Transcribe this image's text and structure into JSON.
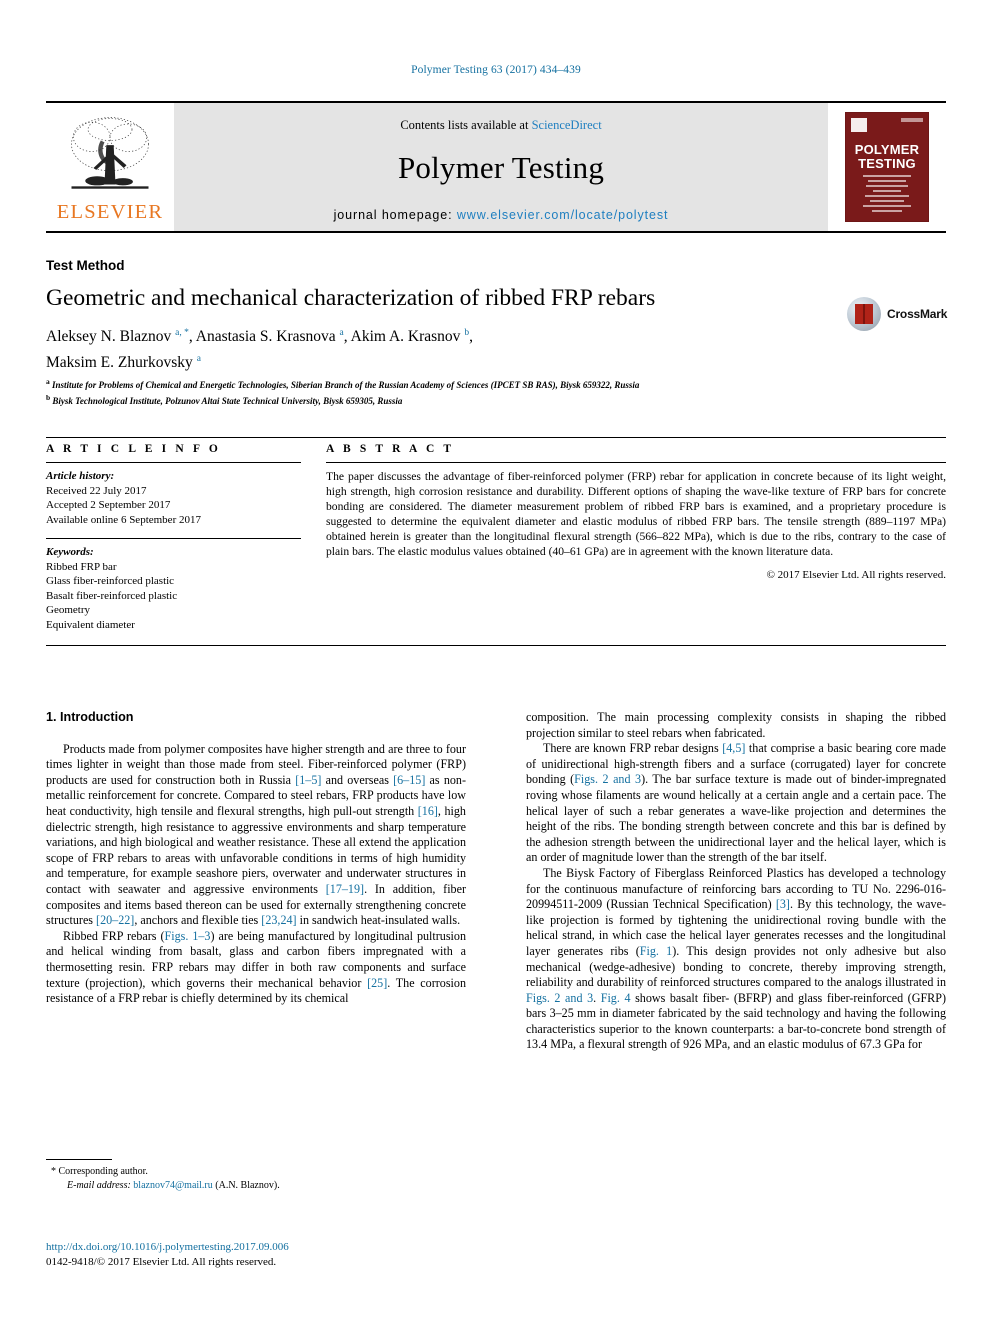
{
  "running_head": "Polymer Testing 63 (2017) 434–439",
  "masthead": {
    "publisher_name": "ELSEVIER",
    "tree_icon": "elsevier-tree-icon",
    "contents_prefix": "Contents lists available at ",
    "contents_link": "ScienceDirect",
    "journal_title": "Polymer Testing",
    "homepage_label": "journal homepage: ",
    "homepage_url": "www.elsevier.com/locate/polytest",
    "cover": {
      "title_line1": "POLYMER",
      "title_line2": "TESTING"
    }
  },
  "article": {
    "section_label": "Test Method",
    "title": "Geometric and mechanical characterization of ribbed FRP rebars",
    "crossmark_label": "CrossMark",
    "authors_line1_a": "Aleksey N. Blaznov ",
    "authors_line1_b": ", Anastasia S. Krasnova ",
    "authors_line1_c": ", Akim A. Krasnov ",
    "authors_line1_d": ",",
    "authors_line2": "Maksim E. Zhurkovsky ",
    "affiliation_a": "Institute for Problems of Chemical and Energetic Technologies, Siberian Branch of the Russian Academy of Sciences (IPCET SB RAS), Biysk 659322, Russia",
    "affiliation_b": "Biysk Technological Institute, Polzunov Altai State Technical University, Biysk 659305, Russia"
  },
  "info": {
    "heading": "A R T I C L E  I N F O",
    "history_label": "Article history:",
    "history": [
      "Received 22 July 2017",
      "Accepted 2 September 2017",
      "Available online 6 September 2017"
    ],
    "keywords_label": "Keywords:",
    "keywords": [
      "Ribbed FRP bar",
      "Glass fiber-reinforced plastic",
      "Basalt fiber-reinforced plastic",
      "Geometry",
      "Equivalent diameter"
    ]
  },
  "abstract": {
    "heading": "A B S T R A C T",
    "text": "The paper discusses the advantage of fiber-reinforced polymer (FRP) rebar for application in concrete because of its light weight, high strength, high corrosion resistance and durability. Different options of shaping the wave-like texture of FRP bars for concrete bonding are considered. The diameter measurement problem of ribbed FRP bars is examined, and a proprietary procedure is suggested to determine the equivalent diameter and elastic modulus of ribbed FRP bars. The tensile strength (889–1197 MPa) obtained herein is greater than the longitudinal flexural strength (566–822 MPa), which is due to the ribs, contrary to the case of plain bars. The elastic modulus values obtained (40–61 GPa) are in agreement with the known literature data.",
    "copyright": "© 2017 Elsevier Ltd. All rights reserved."
  },
  "body": {
    "intro_heading": "1. Introduction",
    "left_paragraphs": [
      {
        "segments": [
          {
            "t": "Products made from polymer composites have higher strength and are three to four times lighter in weight than those made from steel. Fiber-reinforced polymer (FRP) products are used for construction both in Russia ",
            "k": "p"
          },
          {
            "t": "[1–5]",
            "k": "r"
          },
          {
            "t": " and overseas ",
            "k": "p"
          },
          {
            "t": "[6–15]",
            "k": "r"
          },
          {
            "t": " as non-metallic reinforcement for concrete. Compared to steel rebars, FRP products have low heat conductivity, high tensile and flexural strengths, high pull-out strength ",
            "k": "p"
          },
          {
            "t": "[16]",
            "k": "r"
          },
          {
            "t": ", high dielectric strength, high resistance to aggressive environments and sharp temperature variations, and high biological and weather resistance. These all extend the application scope of FRP rebars to areas with unfavorable conditions in terms of high humidity and temperature, for example seashore piers, overwater and underwater structures in contact with seawater and aggressive environments ",
            "k": "p"
          },
          {
            "t": "[17–19]",
            "k": "r"
          },
          {
            "t": ". In addition, fiber composites and items based thereon can be used for externally strengthening concrete structures ",
            "k": "p"
          },
          {
            "t": "[20–22]",
            "k": "r"
          },
          {
            "t": ", anchors and flexible ties ",
            "k": "p"
          },
          {
            "t": "[23,24]",
            "k": "r"
          },
          {
            "t": " in sandwich heat-insulated walls.",
            "k": "p"
          }
        ]
      },
      {
        "segments": [
          {
            "t": "Ribbed FRP rebars (",
            "k": "p"
          },
          {
            "t": "Figs. 1–3",
            "k": "r"
          },
          {
            "t": ") are being manufactured by longitudinal pultrusion and helical winding from basalt, glass and carbon fibers impregnated with a thermosetting resin. FRP rebars may differ in both raw components and surface texture (projection), which governs their mechanical behavior ",
            "k": "p"
          },
          {
            "t": "[25]",
            "k": "r"
          },
          {
            "t": ". The corrosion resistance of a FRP rebar is chiefly determined by its chemical",
            "k": "p"
          }
        ]
      }
    ],
    "right_paragraphs": [
      {
        "indent": false,
        "segments": [
          {
            "t": "composition. The main processing complexity consists in shaping the ribbed projection similar to steel rebars when fabricated.",
            "k": "p"
          }
        ]
      },
      {
        "indent": true,
        "segments": [
          {
            "t": "There are known FRP rebar designs ",
            "k": "p"
          },
          {
            "t": "[4,5]",
            "k": "r"
          },
          {
            "t": " that comprise a basic bearing core made of unidirectional high-strength fibers and a surface (corrugated) layer for concrete bonding (",
            "k": "p"
          },
          {
            "t": "Figs. 2 and 3",
            "k": "r"
          },
          {
            "t": "). The bar surface texture is made out of binder-impregnated roving whose filaments are wound helically at a certain angle and a certain pace. The helical layer of such a rebar generates a wave-like projection and determines the height of the ribs. The bonding strength between concrete and this bar is defined by the adhesion strength between the unidirectional layer and the helical layer, which is an order of magnitude lower than the strength of the bar itself.",
            "k": "p"
          }
        ]
      },
      {
        "indent": true,
        "segments": [
          {
            "t": "The Biysk Factory of Fiberglass Reinforced Plastics has developed a technology for the continuous manufacture of reinforcing bars according to TU No. 2296-016-20994511-2009 (Russian Technical Specification) ",
            "k": "p"
          },
          {
            "t": "[3]",
            "k": "r"
          },
          {
            "t": ". By this technology, the wave-like projection is formed by tightening the unidirectional roving bundle with the helical strand, in which case the helical layer generates recesses and the longitudinal layer generates ribs (",
            "k": "p"
          },
          {
            "t": "Fig. 1",
            "k": "r"
          },
          {
            "t": "). This design provides not only adhesive but also mechanical (wedge-adhesive) bonding to concrete, thereby improving strength, reliability and durability of reinforced structures compared to the analogs illustrated in ",
            "k": "p"
          },
          {
            "t": "Figs. 2 and 3",
            "k": "r"
          },
          {
            "t": ". ",
            "k": "p"
          },
          {
            "t": "Fig. 4",
            "k": "r"
          },
          {
            "t": " shows basalt fiber- (BFRP) and glass fiber-reinforced (GFRP) bars 3–25 mm in diameter fabricated by the said technology and having the following characteristics superior to the known counterparts: a bar-to-concrete bond strength of 13.4 MPa, a flexural strength of 926 MPa, and an elastic modulus of 67.3 GPa for",
            "k": "p"
          }
        ]
      }
    ]
  },
  "footnote": {
    "corresponding": "* Corresponding author.",
    "email_label": "E-mail address: ",
    "email": "blaznov74@mail.ru",
    "email_suffix": " (A.N. Blaznov)."
  },
  "footer": {
    "doi": "http://dx.doi.org/10.1016/j.polymertesting.2017.09.006",
    "issn_line": "0142-9418/© 2017 Elsevier Ltd. All rights reserved."
  },
  "colors": {
    "link": "#1470a0",
    "elsevier_orange": "#E87722",
    "cover_maroon": "#7a1a1a",
    "masthead_gray": "#e4e4e4"
  }
}
